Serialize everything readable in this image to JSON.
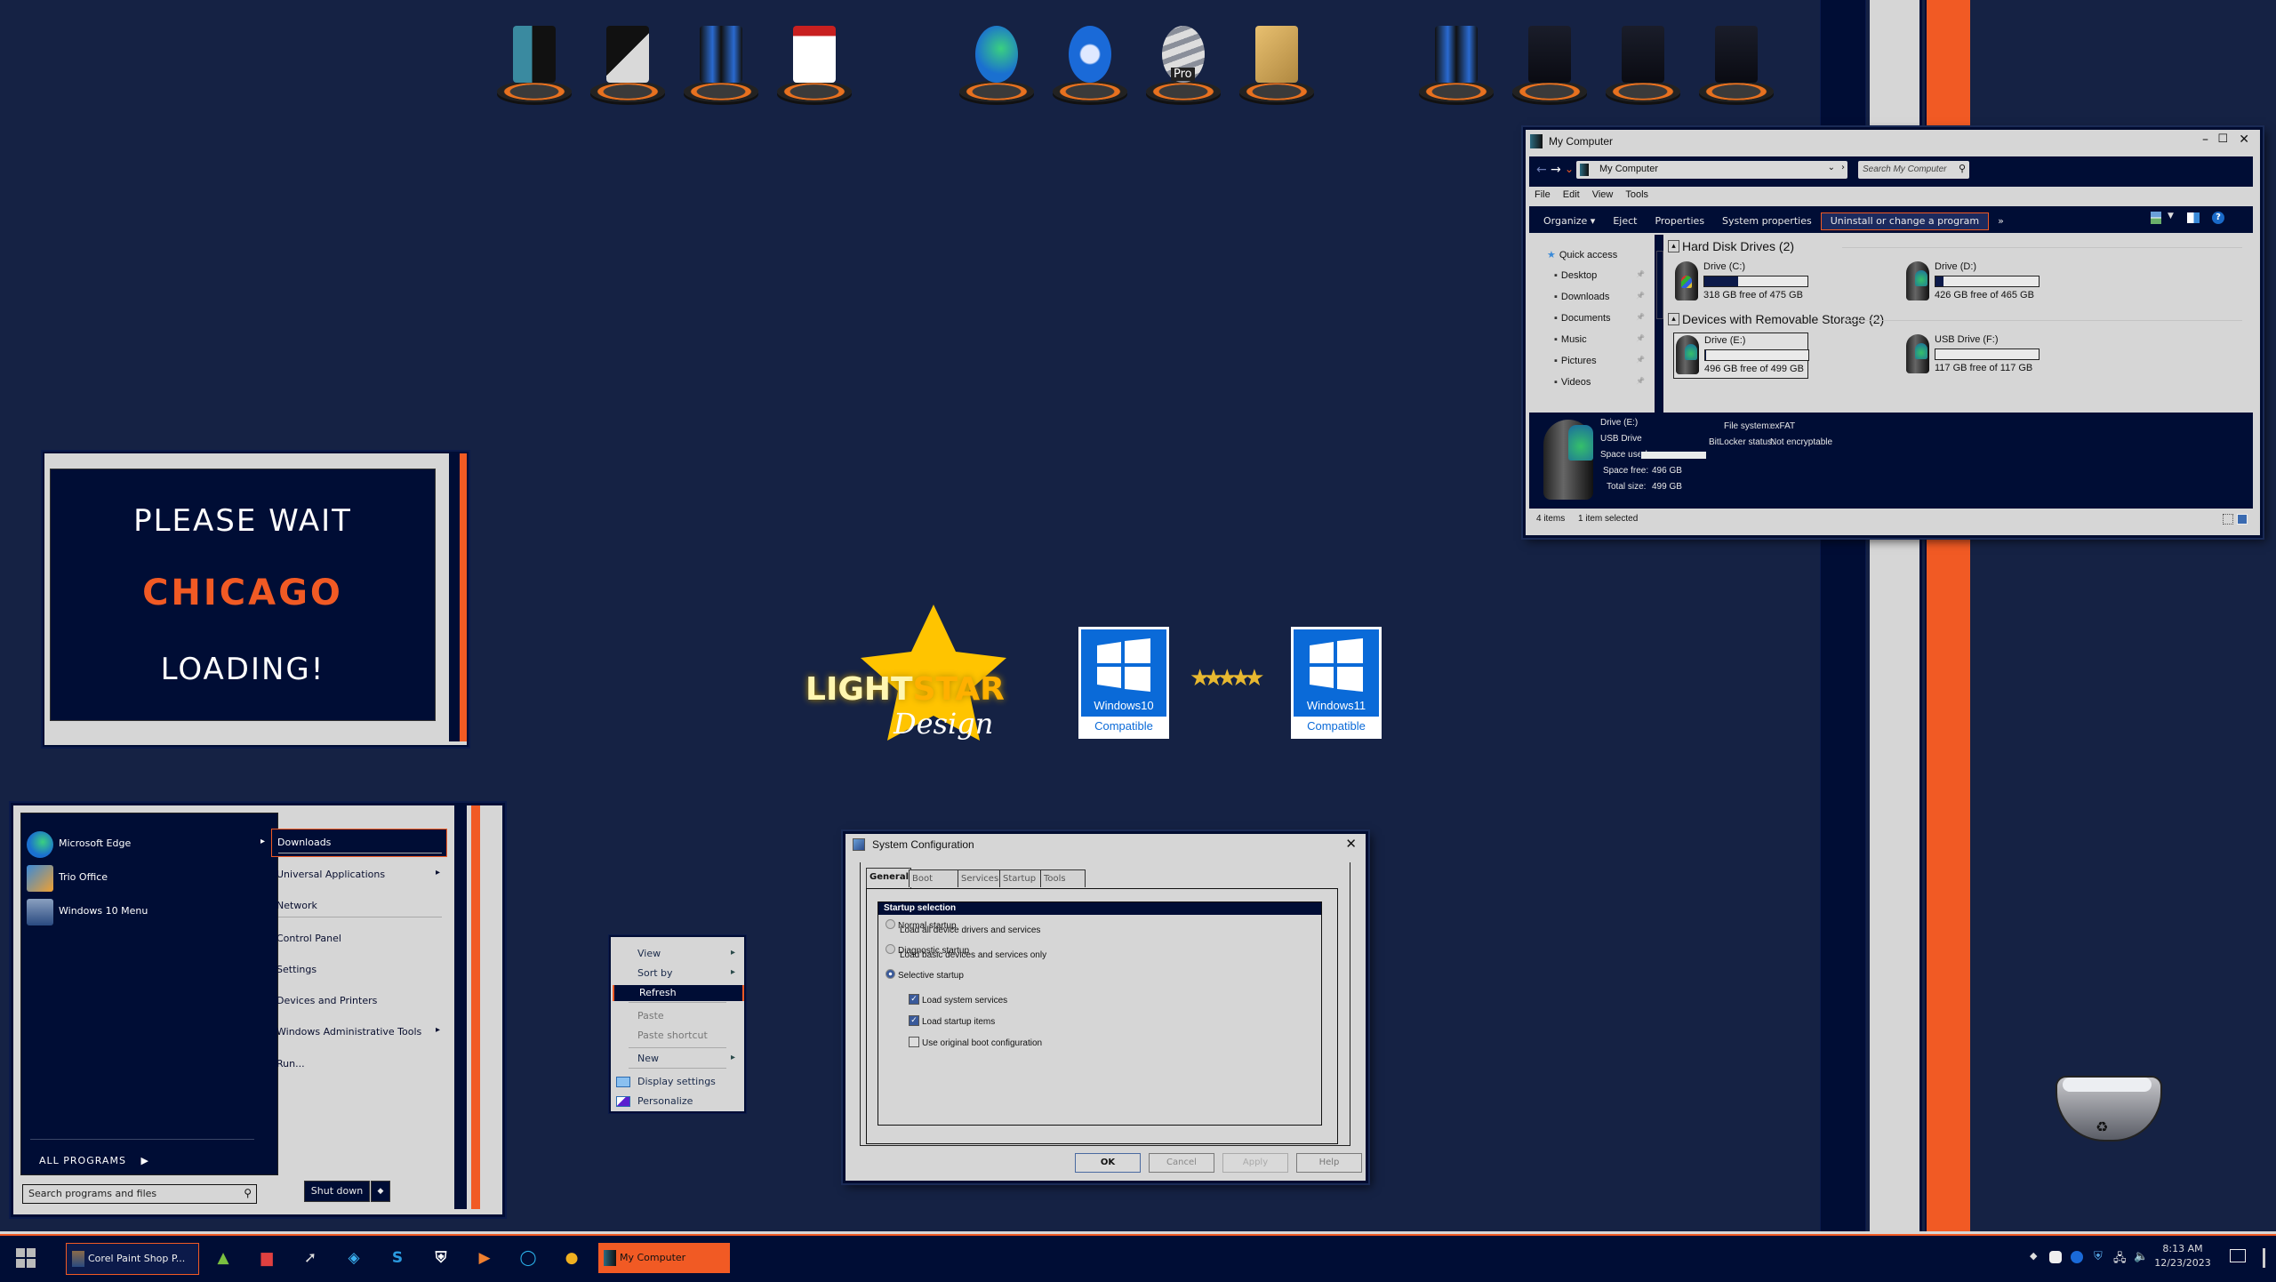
{
  "colors": {
    "desktop_bg": "#152244",
    "navy": "#000d35",
    "orange": "#f15a24",
    "light_gray": "#d6d6d6"
  },
  "desktop_icons": {
    "group1": [
      "computer-icon",
      "documents-icon",
      "network-icon",
      "editor-icon"
    ],
    "group2": [
      "edge-icon",
      "thunderbird-icon",
      "google-earth-pro-icon",
      "address-book-icon"
    ],
    "group3": [
      "drives-icon",
      "folder-icon",
      "folder-icon",
      "folder-icon"
    ],
    "pro_label": "Pro"
  },
  "loading_widget": {
    "line1": "PLEASE WAIT",
    "line2": "CHICAGO",
    "line3": "LOADING!"
  },
  "logo": {
    "light": "LIGHT",
    "star": "STAR",
    "design": "Design"
  },
  "badges": [
    {
      "os": "Windows10",
      "label": "Compatible"
    },
    {
      "os": "Windows11",
      "label": "Compatible"
    }
  ],
  "explorer": {
    "title": "My Computer",
    "address": "My Computer",
    "search_placeholder": "Search My Computer",
    "menu": [
      "File",
      "Edit",
      "View",
      "Tools"
    ],
    "commands": [
      "Organize",
      "Eject",
      "Properties",
      "System properties",
      "Uninstall or change a program"
    ],
    "more": "»",
    "nav": [
      {
        "label": "Quick access"
      },
      {
        "label": "Desktop"
      },
      {
        "label": "Downloads"
      },
      {
        "label": "Documents"
      },
      {
        "label": "Music"
      },
      {
        "label": "Pictures"
      },
      {
        "label": "Videos"
      }
    ],
    "groups": [
      {
        "title": "Hard Disk Drives (2)",
        "drives": [
          {
            "name": "Drive (C:)",
            "free_text": "318 GB free of 475 GB",
            "used_fraction": 0.33
          },
          {
            "name": "Drive (D:)",
            "free_text": "426 GB free of 465 GB",
            "used_fraction": 0.08
          }
        ]
      },
      {
        "title": "Devices with Removable Storage (2)",
        "drives": [
          {
            "name": "Drive (E:)",
            "free_text": "496 GB free of 499 GB",
            "used_fraction": 0.006,
            "selected": true
          },
          {
            "name": "USB Drive (F:)",
            "free_text": "117 GB free of 117 GB",
            "used_fraction": 0.0
          }
        ]
      }
    ],
    "details": {
      "name": "Drive (E:)",
      "type": "USB Drive",
      "space_used_label": "Space used:",
      "space_free_label": "Space free:",
      "space_free": "496 GB",
      "total_size_label": "Total size:",
      "total_size": "499 GB",
      "fs_label": "File system:",
      "fs": "exFAT",
      "bitlocker_label": "BitLocker status:",
      "bitlocker": "Not encryptable"
    },
    "status": {
      "items": "4 items",
      "selected": "1 item selected"
    }
  },
  "start_menu": {
    "pinned": [
      {
        "label": "Microsoft Edge",
        "has_arrow": true
      },
      {
        "label": "Trio Office"
      },
      {
        "label": "Windows 10 Menu"
      }
    ],
    "all_programs": "ALL PROGRAMS",
    "search_placeholder": "Search programs and files",
    "right": [
      {
        "label": "Downloads",
        "highlight": true
      },
      {
        "label": "Universal Applications",
        "has_arrow": true
      },
      {
        "label": "Network"
      },
      {
        "label": "Control Panel"
      },
      {
        "label": "Settings"
      },
      {
        "label": "Devices and Printers"
      },
      {
        "label": "Windows Administrative Tools",
        "has_arrow": true
      },
      {
        "label": "Run..."
      }
    ],
    "shutdown": "Shut down",
    "shutdown_options": "◆"
  },
  "context_menu": {
    "items": [
      {
        "label": "View",
        "has_arrow": true
      },
      {
        "label": "Sort by",
        "has_arrow": true
      },
      {
        "label": "Refresh",
        "highlight": true
      },
      {
        "label": "Paste",
        "disabled": true
      },
      {
        "label": "Paste shortcut",
        "disabled": true
      },
      {
        "label": "New",
        "has_arrow": true
      },
      {
        "label": "Display settings"
      },
      {
        "label": "Personalize"
      }
    ]
  },
  "sysconfig": {
    "title": "System Configuration",
    "tabs": [
      "General",
      "Boot",
      "Services",
      "Startup",
      "Tools"
    ],
    "active_tab": "General",
    "group_title": "Startup selection",
    "options": [
      {
        "label": "Normal startup",
        "desc": "Load all device drivers and services",
        "checked": false
      },
      {
        "label": "Diagnostic startup",
        "desc": "Load basic devices and services only",
        "checked": false
      },
      {
        "label": "Selective startup",
        "checked": true
      }
    ],
    "checkboxes": [
      {
        "label": "Load system services",
        "checked": true
      },
      {
        "label": "Load startup items",
        "checked": true
      },
      {
        "label": "Use original boot configuration",
        "checked": false
      }
    ],
    "buttons": {
      "ok": "OK",
      "cancel": "Cancel",
      "apply": "Apply",
      "help": "Help"
    }
  },
  "taskbar": {
    "tasks": [
      {
        "label": "Corel Paint Shop P...",
        "active": false
      },
      {
        "label": "My Computer",
        "active": true
      }
    ],
    "pinned": [
      "leaf-icon",
      "files-icon",
      "cursor-icon",
      "layers-icon",
      "skype-icon",
      "shield-icon",
      "media-player-icon",
      "cortana-icon",
      "weather-icon"
    ],
    "time": "8:13 AM",
    "date": "12/23/2023"
  }
}
